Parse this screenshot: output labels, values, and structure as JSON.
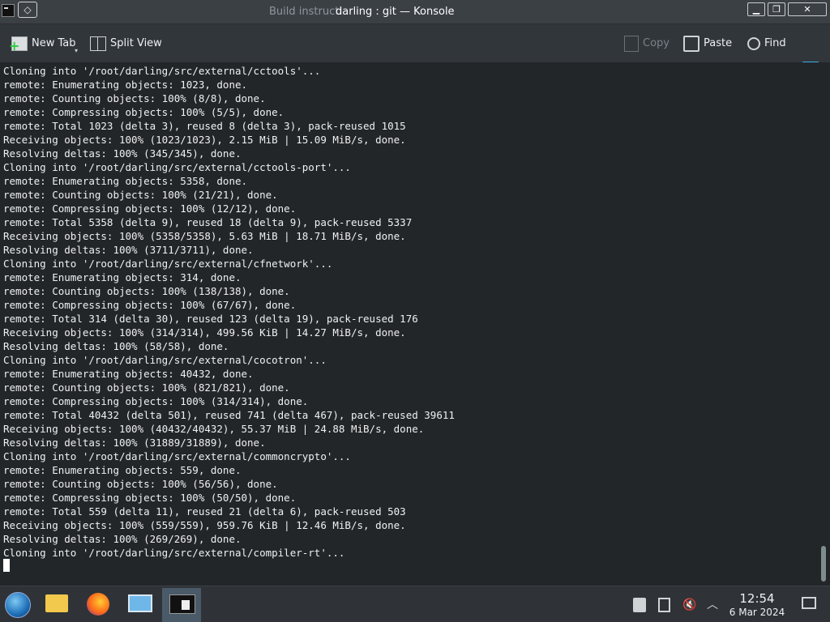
{
  "titlebar": {
    "ghost_title": "Build instructi",
    "title": "darling : git — Konsole"
  },
  "toolbar": {
    "new_tab": "New Tab",
    "split_view": "Split View",
    "copy": "Copy",
    "paste": "Paste",
    "find": "Find"
  },
  "terminal": {
    "lines": [
      "Cloning into '/root/darling/src/external/cctools'...",
      "remote: Enumerating objects: 1023, done.",
      "remote: Counting objects: 100% (8/8), done.",
      "remote: Compressing objects: 100% (5/5), done.",
      "remote: Total 1023 (delta 3), reused 8 (delta 3), pack-reused 1015",
      "Receiving objects: 100% (1023/1023), 2.15 MiB | 15.09 MiB/s, done.",
      "Resolving deltas: 100% (345/345), done.",
      "Cloning into '/root/darling/src/external/cctools-port'...",
      "remote: Enumerating objects: 5358, done.",
      "remote: Counting objects: 100% (21/21), done.",
      "remote: Compressing objects: 100% (12/12), done.",
      "remote: Total 5358 (delta 9), reused 18 (delta 9), pack-reused 5337",
      "Receiving objects: 100% (5358/5358), 5.63 MiB | 18.71 MiB/s, done.",
      "Resolving deltas: 100% (3711/3711), done.",
      "Cloning into '/root/darling/src/external/cfnetwork'...",
      "remote: Enumerating objects: 314, done.",
      "remote: Counting objects: 100% (138/138), done.",
      "remote: Compressing objects: 100% (67/67), done.",
      "remote: Total 314 (delta 30), reused 123 (delta 19), pack-reused 176",
      "Receiving objects: 100% (314/314), 499.56 KiB | 14.27 MiB/s, done.",
      "Resolving deltas: 100% (58/58), done.",
      "Cloning into '/root/darling/src/external/cocotron'...",
      "remote: Enumerating objects: 40432, done.",
      "remote: Counting objects: 100% (821/821), done.",
      "remote: Compressing objects: 100% (314/314), done.",
      "remote: Total 40432 (delta 501), reused 741 (delta 467), pack-reused 39611",
      "Receiving objects: 100% (40432/40432), 55.37 MiB | 24.88 MiB/s, done.",
      "Resolving deltas: 100% (31889/31889), done.",
      "Cloning into '/root/darling/src/external/commoncrypto'...",
      "remote: Enumerating objects: 559, done.",
      "remote: Counting objects: 100% (56/56), done.",
      "remote: Compressing objects: 100% (50/50), done.",
      "remote: Total 559 (delta 11), reused 21 (delta 6), pack-reused 503",
      "Receiving objects: 100% (559/559), 959.76 KiB | 12.46 MiB/s, done.",
      "Resolving deltas: 100% (269/269), done.",
      "Cloning into '/root/darling/src/external/compiler-rt'..."
    ]
  },
  "taskbar": {
    "apps": [
      "file-manager-icon",
      "firefox-icon",
      "system-settings-icon",
      "konsole-icon"
    ],
    "clock": {
      "time": "12:54",
      "date": "6 Mar 2024"
    }
  },
  "colors": {
    "terminal_bg": "#232629",
    "terminal_fg": "#eff0f1",
    "accent": "#3daee9"
  }
}
